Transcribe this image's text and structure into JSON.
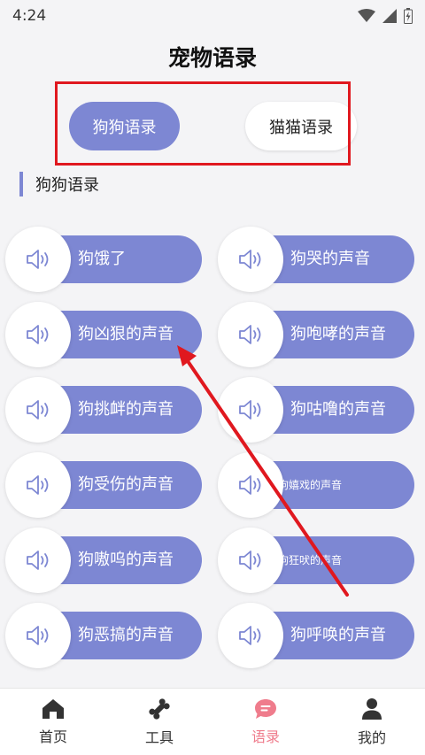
{
  "status": {
    "time": "4:24"
  },
  "title": "宠物语录",
  "tabs": [
    {
      "label": "狗狗语录",
      "active": true
    },
    {
      "label": "猫猫语录",
      "active": false
    }
  ],
  "section_title": "狗狗语录",
  "sounds": [
    {
      "label": "狗饿了"
    },
    {
      "label": "狗哭的声音"
    },
    {
      "label": "狗凶狠的声音"
    },
    {
      "label": "狗咆哮的声音"
    },
    {
      "label": "狗挑衅的声音"
    },
    {
      "label": "狗咕噜的声音"
    },
    {
      "label": "狗受伤的声音"
    },
    {
      "label": "狗嬉戏的声音"
    },
    {
      "label": "狗嗷呜的声音"
    },
    {
      "label": "狗狂吠的声音"
    },
    {
      "label": "狗恶搞的声音"
    },
    {
      "label": "狗呼唤的声音"
    }
  ],
  "nav": [
    {
      "label": "首页",
      "icon": "home-icon"
    },
    {
      "label": "工具",
      "icon": "bone-icon"
    },
    {
      "label": "语录",
      "icon": "chat-icon",
      "active": true
    },
    {
      "label": "我的",
      "icon": "profile-icon"
    }
  ],
  "colors": {
    "accent": "#7d87d3",
    "active_nav": "#ef7c8c",
    "annotation": "#e0181f"
  }
}
